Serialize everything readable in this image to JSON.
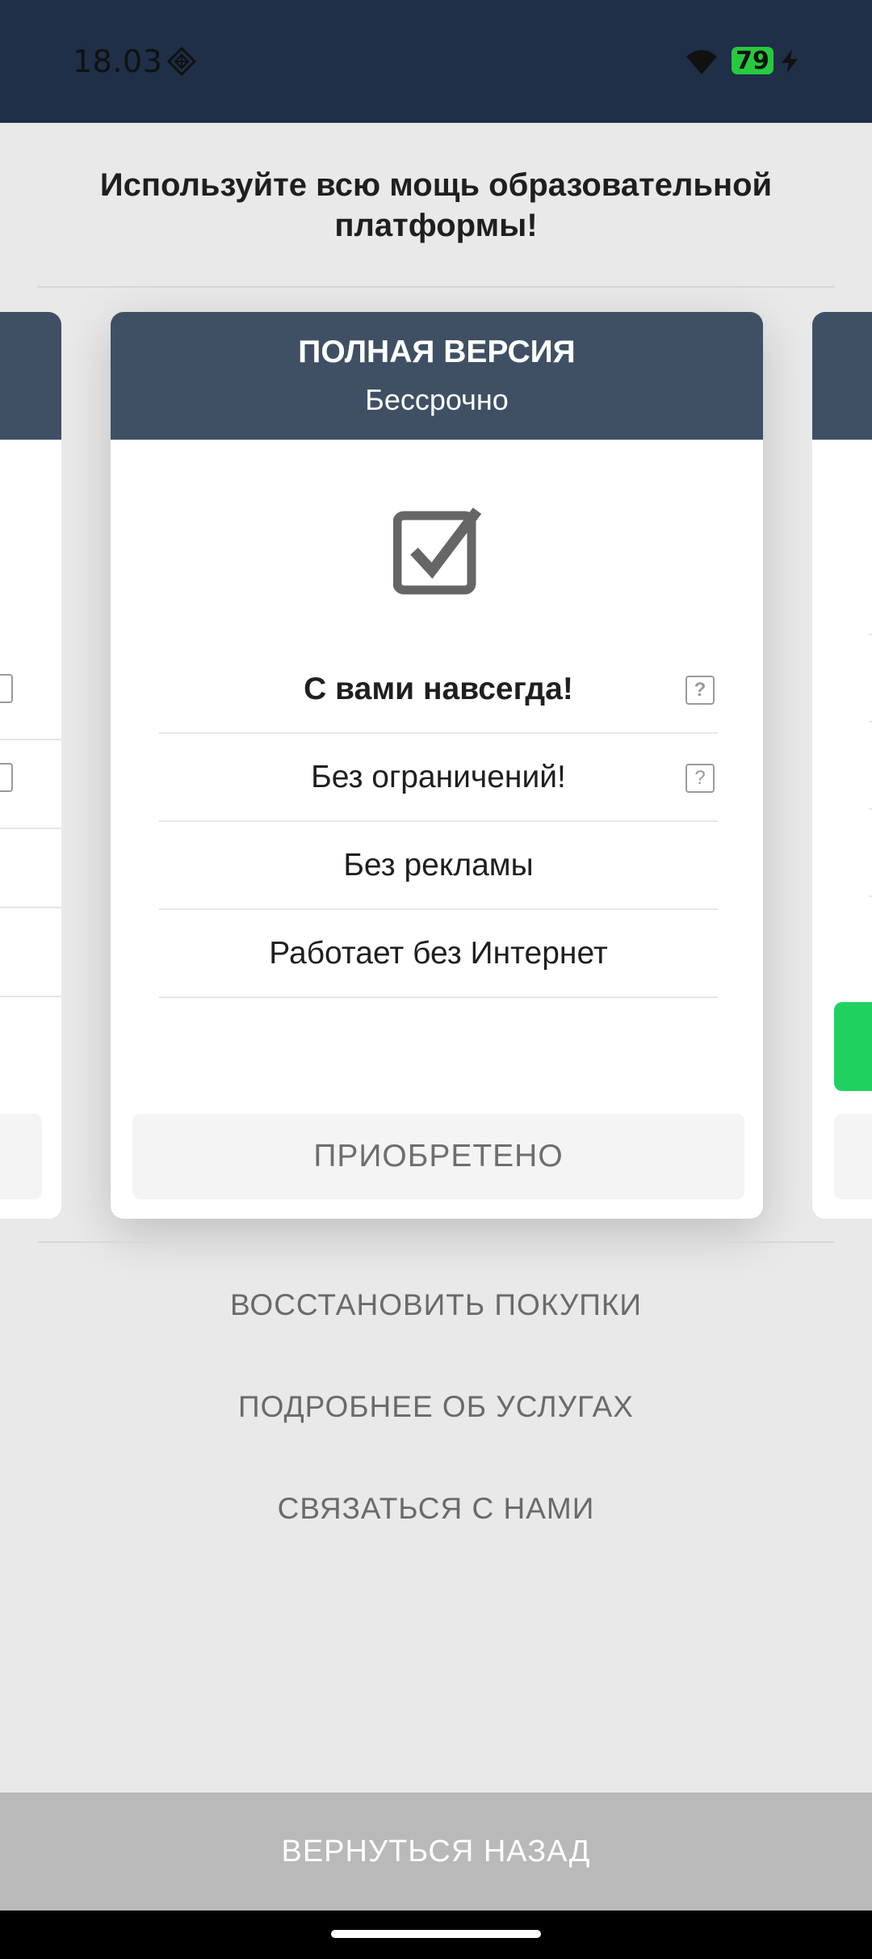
{
  "status_bar": {
    "time": "18.03",
    "battery": "79",
    "icons": [
      "diamond-icon",
      "wifi-icon",
      "battery-icon",
      "charging-bolt-icon"
    ]
  },
  "headline": "Используйте всю мощь образовательной платформы!",
  "plan_card": {
    "title": "ПОЛНАЯ ВЕРСИЯ",
    "subtitle": "Бессрочно",
    "icon": "checkbox-checked-icon",
    "features": [
      {
        "label": "С вами навсегда!",
        "has_help": true,
        "help": "?"
      },
      {
        "label": "Без ограничений!",
        "has_help": true,
        "help": "?"
      },
      {
        "label": "Без рекламы",
        "has_help": false
      },
      {
        "label": "Работает без Интернет",
        "has_help": false
      }
    ],
    "button_label": "ПРИОБРЕТЕНО"
  },
  "links": {
    "restore": "ВОССТАНОВИТЬ ПОКУПКИ",
    "details": "ПОДРОБНЕЕ ОБ УСЛУГАХ",
    "contact": "СВЯЗАТЬСЯ С НАМИ"
  },
  "back_button": "ВЕРНУТЬСЯ НАЗАД",
  "colors": {
    "status_bar": "#1e2f47",
    "card_header": "#3f5064",
    "background": "#e9e9e9",
    "back_bar": "#b9b9b9",
    "accent_green": "#1fd25f",
    "battery_green": "#27c93f"
  }
}
